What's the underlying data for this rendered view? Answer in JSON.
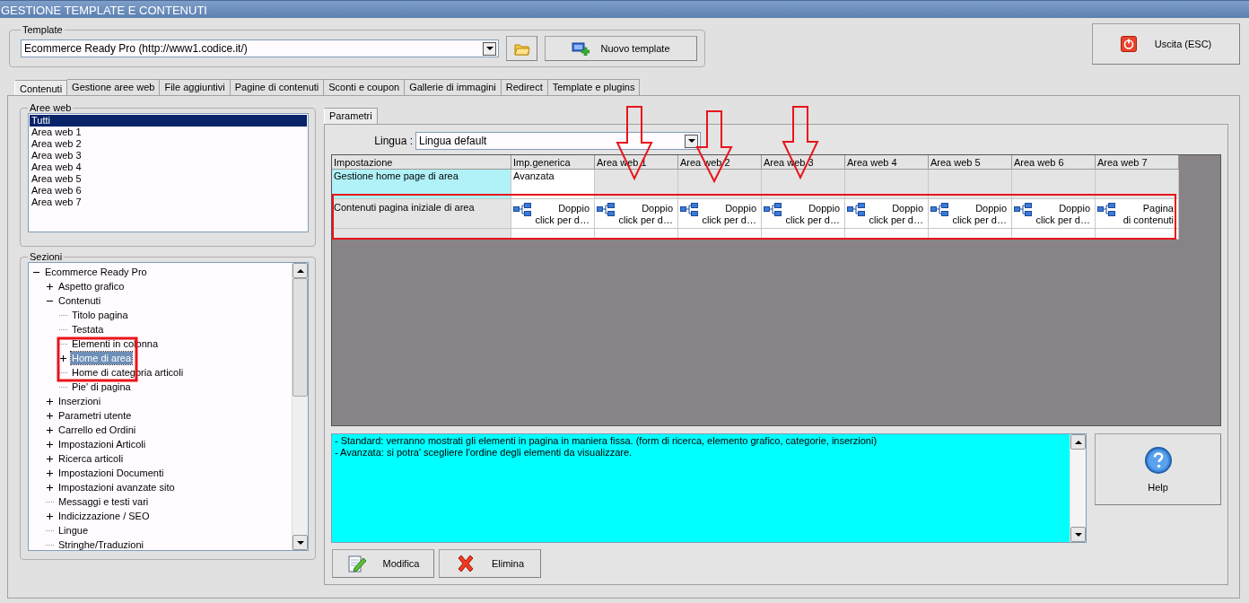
{
  "window": {
    "title": "GESTIONE TEMPLATE E CONTENUTI"
  },
  "template_group": {
    "label": "Template",
    "value": "Ecommerce Ready Pro (http://www1.codice.it/)",
    "new_button": "Nuovo template"
  },
  "exit_button": "Uscita (ESC)",
  "tabs": [
    {
      "label": "Contenuti",
      "selected": true
    },
    {
      "label": "Gestione aree web",
      "selected": false
    },
    {
      "label": "File aggiuntivi",
      "selected": false
    },
    {
      "label": "Pagine di contenuti",
      "selected": false
    },
    {
      "label": "Sconti e coupon",
      "selected": false
    },
    {
      "label": "Gallerie di immagini",
      "selected": false
    },
    {
      "label": "Redirect",
      "selected": false
    },
    {
      "label": "Template e plugins",
      "selected": false
    }
  ],
  "aree_web": {
    "label": "Aree web",
    "items": [
      {
        "label": "Tutti",
        "selected": true
      },
      {
        "label": "Area web 1",
        "selected": false
      },
      {
        "label": "Area web 2",
        "selected": false
      },
      {
        "label": "Area web 3",
        "selected": false
      },
      {
        "label": "Area web 4",
        "selected": false
      },
      {
        "label": "Area web 5",
        "selected": false
      },
      {
        "label": "Area web 6",
        "selected": false
      },
      {
        "label": "Area web 7",
        "selected": false
      }
    ]
  },
  "sezioni": {
    "label": "Sezioni",
    "tree": [
      {
        "label": "Ecommerce Ready Pro",
        "expanded": true,
        "selected": false,
        "children": [
          {
            "label": "Aspetto grafico",
            "expanded": false,
            "selected": false
          },
          {
            "label": "Contenuti",
            "expanded": true,
            "selected": false,
            "children": [
              {
                "label": "Titolo pagina",
                "selected": false
              },
              {
                "label": "Testata",
                "selected": false
              },
              {
                "label": "Elementi in colonna",
                "selected": false
              },
              {
                "label": "Home di area",
                "expanded": false,
                "selected": true
              },
              {
                "label": "Home di categoria articoli",
                "selected": false
              },
              {
                "label": "Pie' di pagina",
                "selected": false
              }
            ]
          },
          {
            "label": "Inserzioni",
            "expanded": false,
            "selected": false
          },
          {
            "label": "Parametri utente",
            "expanded": false,
            "selected": false
          },
          {
            "label": "Carrello ed Ordini",
            "expanded": false,
            "selected": false
          },
          {
            "label": "Impostazioni Articoli",
            "expanded": false,
            "selected": false
          },
          {
            "label": "Ricerca articoli",
            "expanded": false,
            "selected": false
          },
          {
            "label": "Impostazioni Documenti",
            "expanded": false,
            "selected": false
          },
          {
            "label": "Impostazioni avanzate sito",
            "expanded": false,
            "selected": false
          },
          {
            "label": "Messaggi e testi vari",
            "selected": false
          },
          {
            "label": "Indicizzazione / SEO",
            "expanded": false,
            "selected": false
          },
          {
            "label": "Lingue",
            "selected": false
          },
          {
            "label": "Stringhe/Traduzioni",
            "selected": false
          }
        ]
      }
    ]
  },
  "parametri": {
    "tab": "Parametri",
    "lingua_label": "Lingua :",
    "lingua_value": "Lingua default",
    "table": {
      "columns": [
        "Impostazione",
        "Imp.generica",
        "Area web 1",
        "Area web 2",
        "Area web 3",
        "Area web 4",
        "Area web 5",
        "Area web 6",
        "Area web 7"
      ],
      "rows": [
        [
          {
            "kind": "label",
            "text": "Gestione home page di area",
            "highlight": true
          },
          {
            "kind": "value",
            "text": "Avanzata"
          },
          {
            "kind": "empty"
          },
          {
            "kind": "empty"
          },
          {
            "kind": "empty"
          },
          {
            "kind": "empty"
          },
          {
            "kind": "empty"
          },
          {
            "kind": "empty"
          },
          {
            "kind": "empty"
          }
        ],
        [
          {
            "kind": "label",
            "text": "Contenuti pagina iniziale di area",
            "highlight": false
          },
          {
            "kind": "link",
            "lines": [
              "Doppio",
              "click per d…"
            ]
          },
          {
            "kind": "link",
            "lines": [
              "Doppio",
              "click per d…"
            ]
          },
          {
            "kind": "link",
            "lines": [
              "Doppio",
              "click per d…"
            ]
          },
          {
            "kind": "link",
            "lines": [
              "Doppio",
              "click per d…"
            ]
          },
          {
            "kind": "link",
            "lines": [
              "Doppio",
              "click per d…"
            ]
          },
          {
            "kind": "link",
            "lines": [
              "Doppio",
              "click per d…"
            ]
          },
          {
            "kind": "link",
            "lines": [
              "Doppio",
              "click per d…"
            ]
          },
          {
            "kind": "link",
            "lines": [
              "Pagina",
              "di contenuti"
            ]
          }
        ],
        [
          {
            "kind": "label",
            "text": "",
            "highlight": false
          },
          {
            "kind": "blank"
          },
          {
            "kind": "blank"
          },
          {
            "kind": "blank"
          },
          {
            "kind": "blank"
          },
          {
            "kind": "blank"
          },
          {
            "kind": "blank"
          },
          {
            "kind": "blank"
          },
          {
            "kind": "blank"
          }
        ]
      ]
    },
    "description": [
      "- Standard: verranno mostrati gli elementi in pagina in maniera fissa. (form di ricerca, elemento grafico, categorie, inserzioni)",
      "- Avanzata: si potra' scegliere l'ordine degli elementi da visualizzare."
    ],
    "help_button": "Help",
    "buttons": [
      {
        "kind": "edit",
        "label": "Modifica"
      },
      {
        "kind": "delete",
        "label": "Elimina"
      }
    ]
  }
}
